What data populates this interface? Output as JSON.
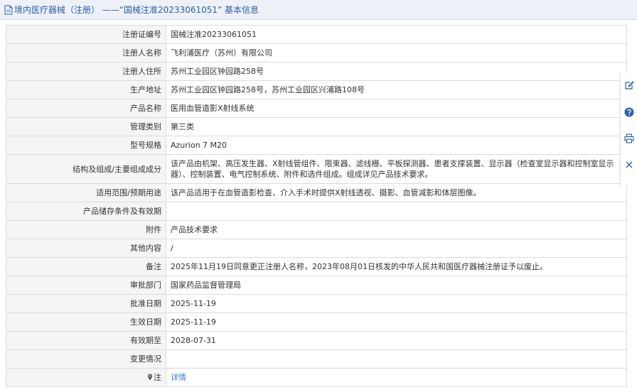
{
  "header": {
    "title": "境内医疗器械（注册） ——“国械注准20233061051” 基本信息"
  },
  "rows": [
    {
      "label": "注册证编号",
      "value": "国械注准20233061051"
    },
    {
      "label": "注册人名称",
      "value": "飞利浦医疗（苏州）有限公司"
    },
    {
      "label": "注册人住所",
      "value": "苏州工业园区钟园路258号"
    },
    {
      "label": "生产地址",
      "value": "苏州工业园区钟园路258号，苏州工业园区兴浦路108号"
    },
    {
      "label": "产品名称",
      "value": "医用血管造影X射线系统"
    },
    {
      "label": "管理类别",
      "value": "第三类"
    },
    {
      "label": "型号规格",
      "value": "Azurion 7 M20"
    },
    {
      "label": "结构及组成/主要组成成分",
      "value": "该产品由机架、高压发生器、X射线管组件、限束器、滤线栅、平板探测器、患者支撑装置、显示器（检查室显示器和控制室显示器）、控制装置、电气控制系统、附件和选件组成。组成详见产品技术要求。"
    },
    {
      "label": "适用范围/预期用途",
      "value": "该产品适用于在血管造影检查、介入手术时提供X射线透视、摄影、血管减影和体层图像。"
    },
    {
      "label": "产品储存条件及有效期",
      "value": ""
    },
    {
      "label": "附件",
      "value": "产品技术要求"
    },
    {
      "label": "其他内容",
      "value": "/"
    },
    {
      "label": "备注",
      "value": "2025年11月19日同意更正注册人名称，2023年08月01日核发的中华人民共和国医疗器械注册证予以废止。"
    },
    {
      "label": "审批部门",
      "value": "国家药品监督管理局"
    },
    {
      "label": "批准日期",
      "value": "2025-11-19"
    },
    {
      "label": "生效日期",
      "value": "2025-11-19"
    },
    {
      "label": "有效期至",
      "value": "2028-07-31"
    },
    {
      "label": "变更情况",
      "value": ""
    }
  ],
  "note": {
    "label": "注",
    "link": "详情"
  },
  "toolbar": {
    "items": [
      "edit-icon",
      "help-icon",
      "print-icon",
      "close-icon"
    ]
  }
}
